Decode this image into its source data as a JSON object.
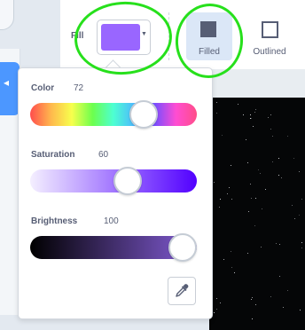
{
  "toolbar": {
    "fill_label": "Fill",
    "fill_color": "#9966FF",
    "fill_swatch_icon": "caret-down-icon",
    "modes": [
      {
        "label": "Filled",
        "icon": "filled-square-icon",
        "selected": true
      },
      {
        "label": "Outlined",
        "icon": "outlined-square-icon",
        "selected": false
      }
    ]
  },
  "color_picker": {
    "color": {
      "label": "Color",
      "value": "72"
    },
    "saturation": {
      "label": "Saturation",
      "value": "60"
    },
    "brightness": {
      "label": "Brightness",
      "value": "100"
    },
    "eyedropper_icon": "eyedropper-icon"
  },
  "colors": {
    "accent": "#4c97ff",
    "selected_fill": "#9966FF",
    "annotation_green": "#27e01c",
    "canvas_bg": "#050607"
  }
}
